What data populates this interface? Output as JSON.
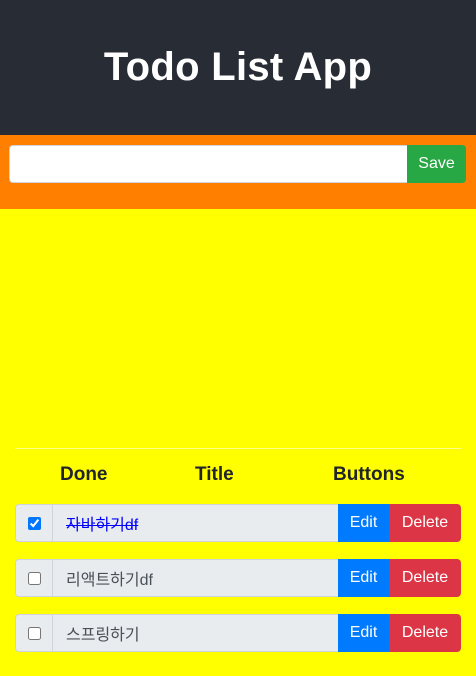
{
  "app": {
    "title": "Todo List App"
  },
  "input": {
    "value": "",
    "placeholder": "",
    "save_label": "Save"
  },
  "table": {
    "headers": {
      "done": "Done",
      "title": "Title",
      "buttons": "Buttons"
    },
    "rows": [
      {
        "done": true,
        "title": "자바하기df",
        "edit_label": "Edit",
        "delete_label": "Delete"
      },
      {
        "done": false,
        "title": "리액트하기df",
        "edit_label": "Edit",
        "delete_label": "Delete"
      },
      {
        "done": false,
        "title": "스프링하기",
        "edit_label": "Edit",
        "delete_label": "Delete"
      }
    ]
  },
  "colors": {
    "header_bg": "#282c34",
    "input_bar_bg": "#ff8000",
    "page_bg": "#ffff00",
    "save": "#28a745",
    "edit": "#007bff",
    "delete": "#dc3545",
    "done_text": "#0000ff"
  }
}
